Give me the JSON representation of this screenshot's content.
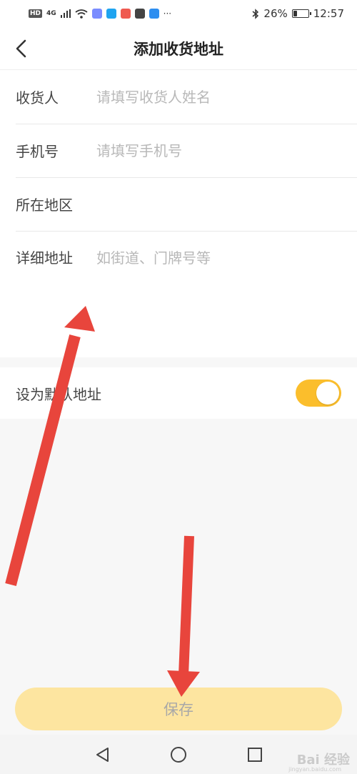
{
  "status_bar": {
    "network_badge": "HD",
    "network_type": "4G",
    "more": "···",
    "battery_percent": "26%",
    "battery_level": 0.26,
    "time": "12:57"
  },
  "header": {
    "title": "添加收货地址"
  },
  "form": {
    "receiver": {
      "label": "收货人",
      "placeholder": "请填写收货人姓名"
    },
    "phone": {
      "label": "手机号",
      "placeholder": "请填写手机号"
    },
    "region": {
      "label": "所在地区",
      "value": ""
    },
    "address": {
      "label": "详细地址",
      "placeholder": "如街道、门牌号等"
    }
  },
  "default_address": {
    "label": "设为默认地址",
    "enabled": true
  },
  "save_button": {
    "label": "保存"
  },
  "colors": {
    "accent": "#fbbe2c",
    "save_button_bg": "#fde5a0",
    "annotation_arrow": "#e8453c"
  },
  "watermark": {
    "text": "Bai 经验",
    "sub": "jingyan.baidu.com"
  }
}
